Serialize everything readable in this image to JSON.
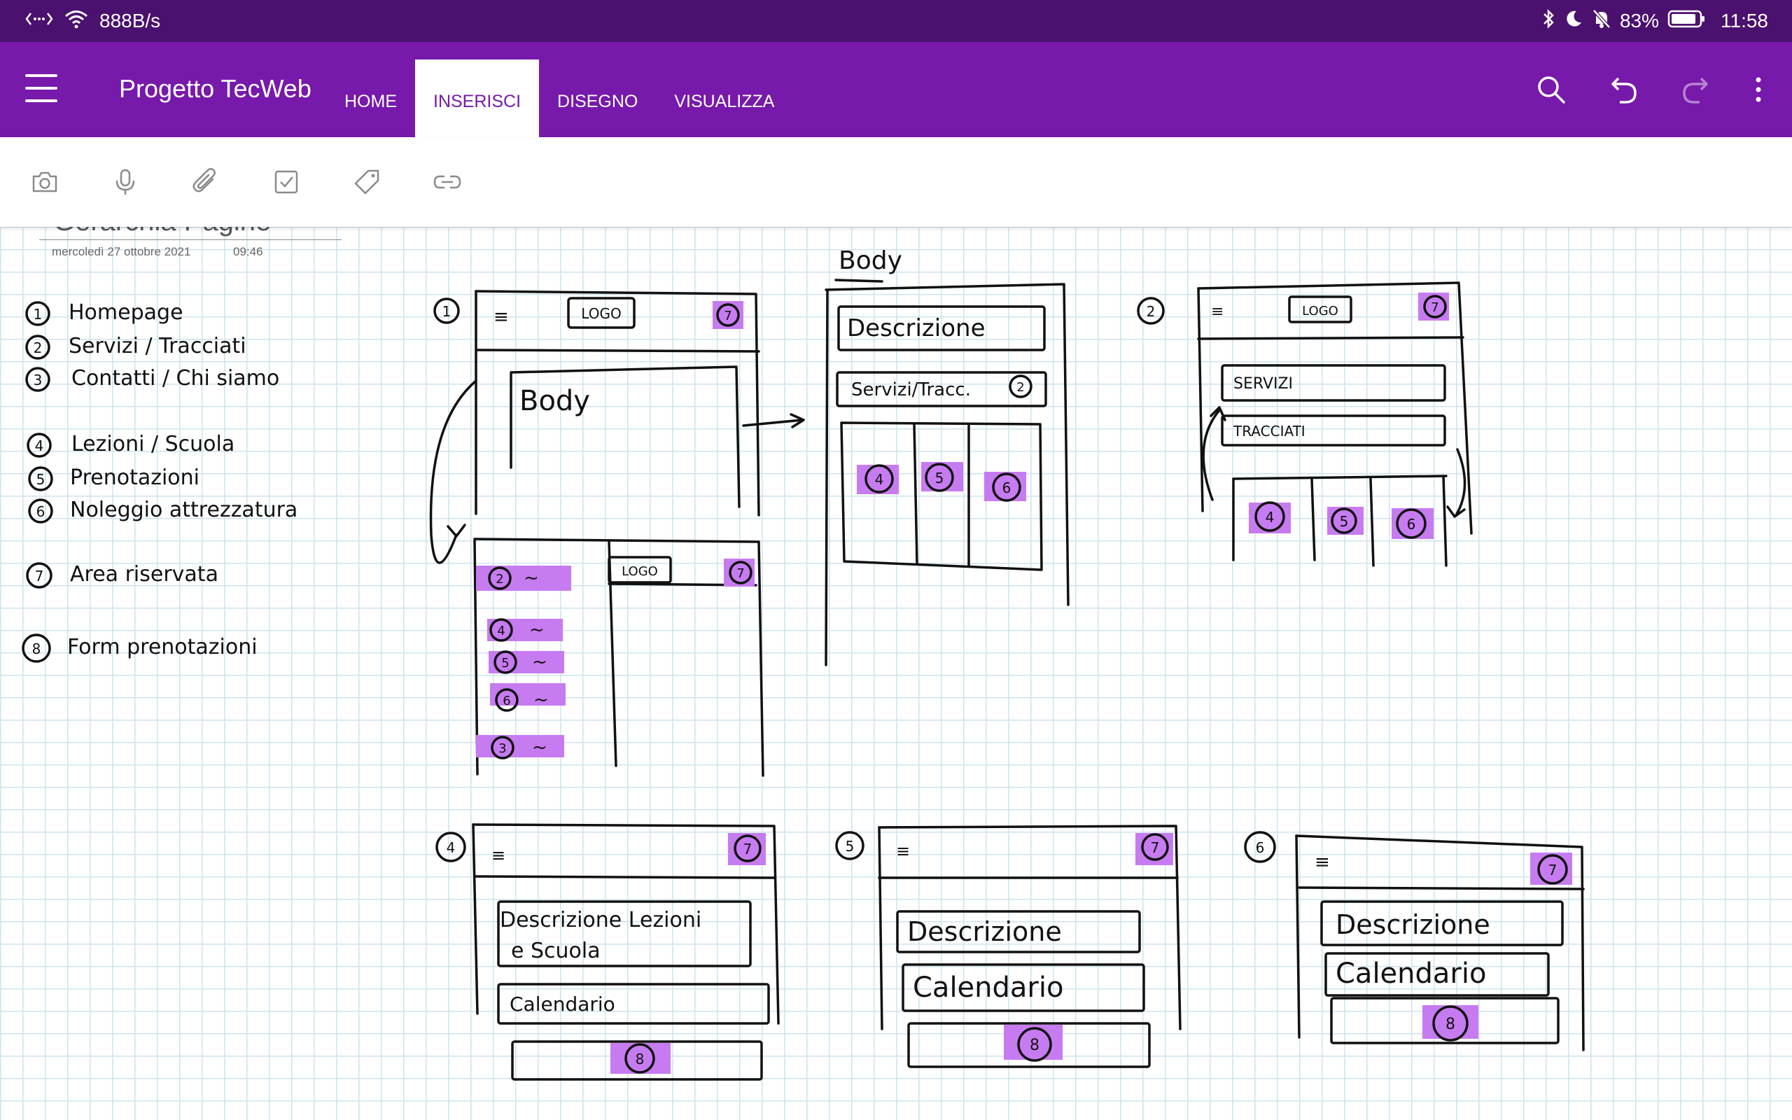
{
  "status_bar": {
    "network_speed": "888B/s",
    "battery": "83%",
    "time": "11:58"
  },
  "app_bar": {
    "notebook_title": "Progetto TecWeb",
    "tabs": [
      "HOME",
      "INSERISCI",
      "DISEGNO",
      "VISUALIZZA"
    ],
    "active_tab": "INSERISCI",
    "icons": [
      "search-icon",
      "undo-icon",
      "redo-icon",
      "more-icon"
    ],
    "colors": {
      "status_bar": "#4b116e",
      "app_bar": "#7719aa",
      "highlight": "#c77bf0"
    }
  },
  "toolbar": {
    "tools": [
      "camera-icon",
      "microphone-icon",
      "attachment-icon",
      "checkbox-icon",
      "tag-icon",
      "link-icon"
    ]
  },
  "page": {
    "title": "Gerarchia Pagine",
    "date": "mercoledì 27 ottobre 2021",
    "time": "09:46"
  },
  "sketch": {
    "legend": [
      {
        "num": "1",
        "text": "Homepage"
      },
      {
        "num": "2",
        "text": "Servizi / Tracciati"
      },
      {
        "num": "3",
        "text": "Contatti / Chi siamo"
      },
      {
        "num": "4",
        "text": "Lezioni / Scuola"
      },
      {
        "num": "5",
        "text": "Prenotazioni"
      },
      {
        "num": "6",
        "text": "Noleggio attrezzatura"
      },
      {
        "num": "7",
        "text": "Area riservata"
      },
      {
        "num": "8",
        "text": "Form prenotazioni"
      }
    ],
    "labels": {
      "logo": "LOGO",
      "body": "Body",
      "descrizione": "Descrizione",
      "servizi_tracc": "Servizi/Tracc.",
      "servizi": "SERVIZI",
      "tracciati": "TRACCIATI",
      "descrizione_lezioni": "Descrizione Lezioni",
      "e_scuola": "e Scuola",
      "calendario": "Calendario",
      "menu_glyph": "≡",
      "tilde": "~"
    }
  }
}
